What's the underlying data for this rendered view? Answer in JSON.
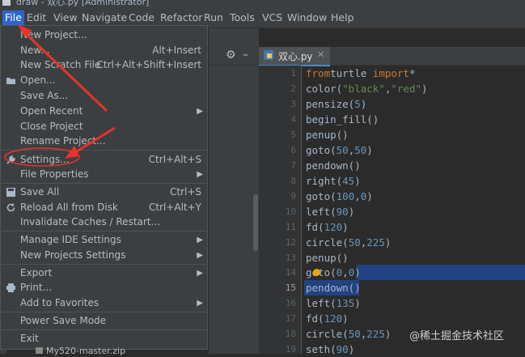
{
  "window": {
    "title": "draw - 双心.py [Administrator]"
  },
  "menubar": {
    "items": [
      "File",
      "Edit",
      "View",
      "Navigate",
      "Code",
      "Refactor",
      "Run",
      "Tools",
      "VCS",
      "Window",
      "Help"
    ]
  },
  "file_menu": {
    "new_project": "New Project...",
    "new": "New...",
    "new_shortcut": "Alt+Insert",
    "new_scratch": "New Scratch File",
    "new_scratch_shortcut": "Ctrl+Alt+Shift+Insert",
    "open": "Open...",
    "save_as": "Save As...",
    "open_recent": "Open Recent",
    "close_project": "Close Project",
    "rename_project": "Rename Project...",
    "settings": "Settings...",
    "settings_shortcut": "Ctrl+Alt+S",
    "file_properties": "File Properties",
    "save_all": "Save All",
    "save_all_shortcut": "Ctrl+S",
    "reload": "Reload All from Disk",
    "reload_shortcut": "Ctrl+Alt+Y",
    "invalidate": "Invalidate Caches / Restart...",
    "manage_ide": "Manage IDE Settings",
    "new_projects_settings": "New Projects Settings",
    "export": "Export",
    "print": "Print...",
    "add_favorites": "Add to Favorites",
    "power_save": "Power Save Mode",
    "exit": "Exit"
  },
  "project": {
    "partial_item": "My520-master.zip"
  },
  "editor": {
    "tab": "双心.py",
    "line_numbers": [
      "1",
      "2",
      "3",
      "4",
      "5",
      "6",
      "7",
      "8",
      "9",
      "10",
      "11",
      "12",
      "13",
      "14",
      "15",
      "16",
      "17",
      "18",
      "19"
    ]
  },
  "watermark": "@稀土掘金技术社区",
  "colors": {
    "accent": "#2f65ca",
    "selection": "#214283",
    "annotation": "#e8322b",
    "keyword": "#cc7832",
    "number": "#6897bb",
    "string": "#6a8759"
  },
  "icons": [
    "open-folder-icon",
    "wrench-icon",
    "save-icon",
    "reload-icon",
    "print-icon",
    "settings-gear-icon",
    "python-file-icon",
    "lightbulb-icon"
  ]
}
